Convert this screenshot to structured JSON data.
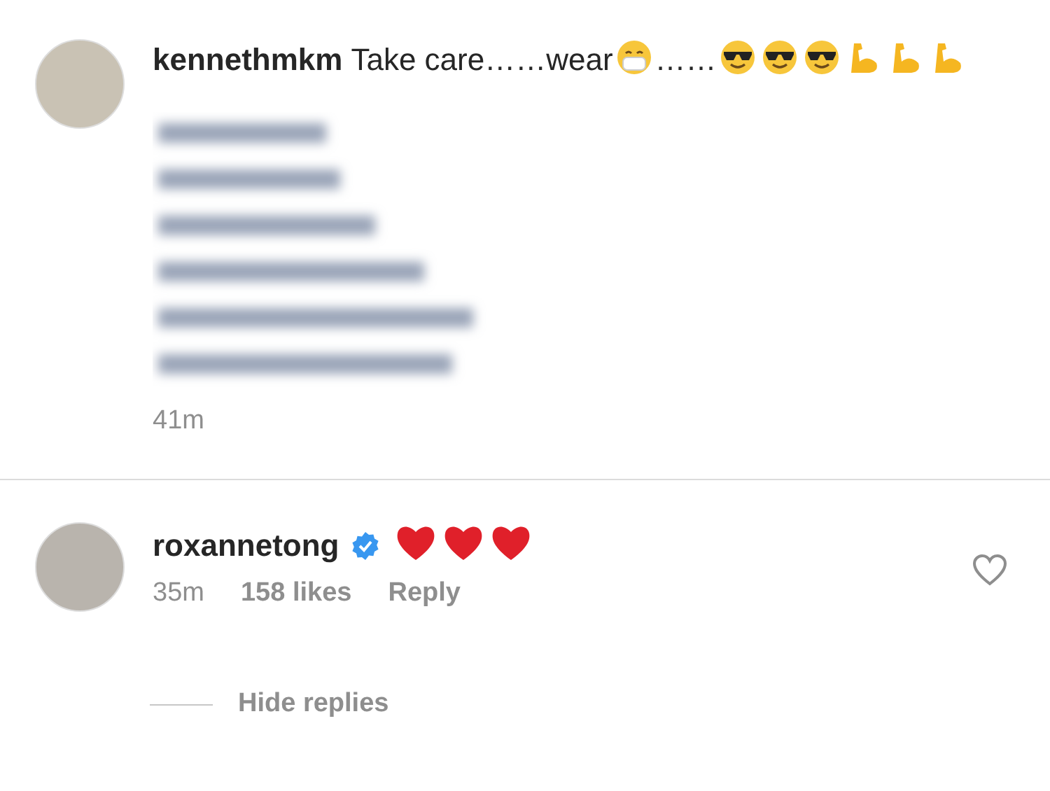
{
  "comments": [
    {
      "username": "kennethmkm",
      "verified": false,
      "body": [
        {
          "kind": "text",
          "text": "Take care……wear"
        },
        {
          "kind": "mask"
        },
        {
          "kind": "text",
          "text": "……"
        },
        {
          "kind": "sunglasses"
        },
        {
          "kind": "sunglasses"
        },
        {
          "kind": "sunglasses"
        },
        {
          "kind": "flex"
        },
        {
          "kind": "flex"
        },
        {
          "kind": "flex"
        }
      ],
      "blurred": true,
      "time": "41m",
      "like_button": false
    },
    {
      "username": "roxannetong",
      "verified": true,
      "body": [
        {
          "kind": "heart"
        },
        {
          "kind": "heart"
        },
        {
          "kind": "heart"
        }
      ],
      "blurred": false,
      "time": "35m",
      "likes": "158 likes",
      "reply": "Reply",
      "like_button": true,
      "hide_replies": "Hide replies"
    }
  ]
}
